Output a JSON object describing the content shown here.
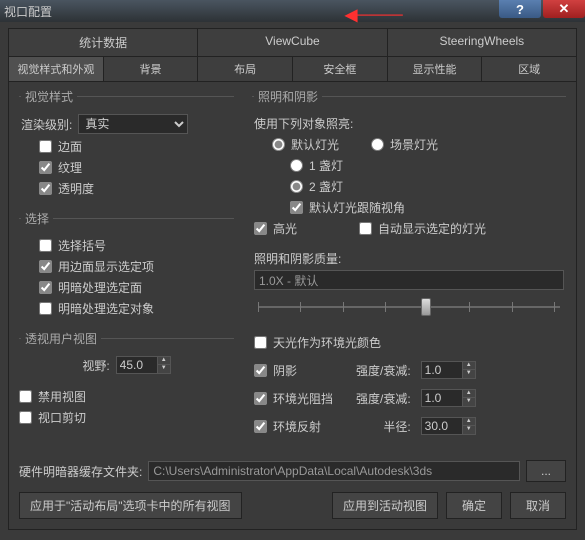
{
  "title": "视口配置",
  "tabs": {
    "items": [
      "统计数据",
      "ViewCube",
      "SteeringWheels"
    ]
  },
  "subtabs": {
    "items": [
      "视觉样式和外观",
      "背景",
      "布局",
      "安全框",
      "显示性能",
      "区域"
    ]
  },
  "visual": {
    "legend": "视觉样式",
    "render_label": "渲染级别:",
    "render_value": "真实",
    "edge": "边面",
    "texture": "纹理",
    "transparency": "透明度"
  },
  "select": {
    "legend": "选择",
    "bracket": "选择括号",
    "edge_sel": "用边面显示选定项",
    "shade_sel": "明暗处理选定面",
    "shade_obj": "明暗处理选定对象"
  },
  "persp": {
    "legend": "透视用户视图",
    "fov_label": "视野:",
    "fov_value": "45.0"
  },
  "disable": "禁用视图",
  "clip": "视口剪切",
  "light": {
    "legend": "照明和阴影",
    "use_label": "使用下列对象照亮:",
    "default": "默认灯光",
    "scene": "场景灯光",
    "one": "1 盏灯",
    "two": "2 盏灯",
    "follow": "默认灯光跟随视角",
    "highlight": "高光",
    "autoshow": "自动显示选定的灯光",
    "quality_label": "照明和阴影质量:",
    "quality_value": "1.0X - 默认",
    "skylight": "天光作为环境光颜色",
    "shadow": "阴影",
    "ao": "环境光阻挡",
    "refl": "环境反射",
    "intensity1": "强度/衰减:",
    "intensity2": "强度/衰减:",
    "radius": "半径:",
    "v1": "1.0",
    "v2": "1.0",
    "v3": "30.0"
  },
  "cache": {
    "label": "硬件明暗器缓存文件夹:",
    "value": "C:\\Users\\Administrator\\AppData\\Local\\Autodesk\\3ds",
    "browse": "..."
  },
  "footer": {
    "apply_all": "应用于\"活动布局\"选项卡中的所有视图",
    "apply_active": "应用到活动视图",
    "ok": "确定",
    "cancel": "取消"
  }
}
